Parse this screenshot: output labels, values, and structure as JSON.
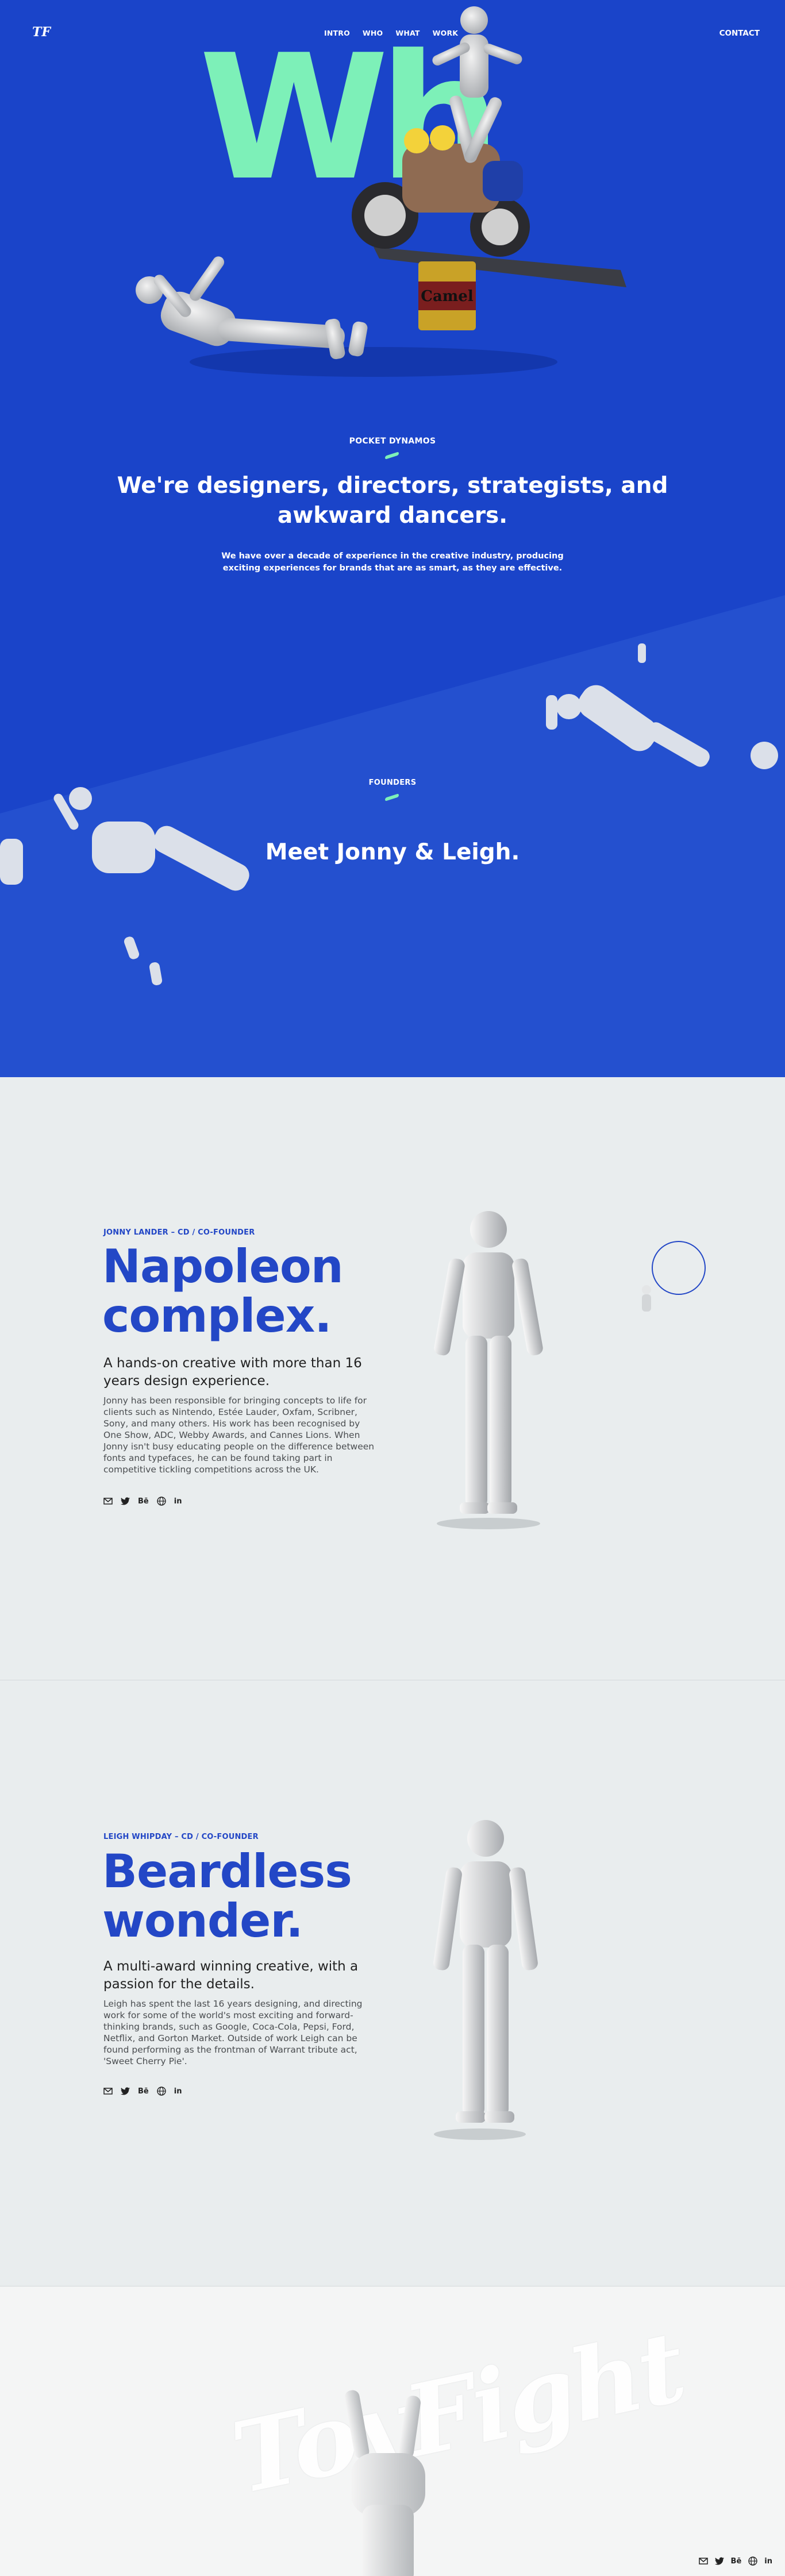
{
  "header": {
    "logo": "TF",
    "nav": [
      "INTRO",
      "WHO",
      "WHAT",
      "WORK"
    ],
    "contact": "CONTACT"
  },
  "hero": {
    "big_word": "Wh",
    "eyebrow": "POCKET DYNAMOS",
    "headline": "We're designers, directors, strategists, and awkward dancers.",
    "lede": "We have over a decade of experience in the creative industry, producing exciting experiences for brands that are as smart, as they are effective."
  },
  "founders": {
    "eyebrow": "FOUNDERS",
    "headline": "Meet Jonny & Leigh."
  },
  "profiles": [
    {
      "role": "JONNY LANDER – CD / CO-FOUNDER",
      "title": "Napoleon complex.",
      "subtitle": "A hands-on creative with more than 16 years design experience.",
      "body": "Jonny has been responsible for bringing concepts to life for clients such as Nintendo, Estée Lauder, Oxfam, Scribner, Sony, and many others. His work has been recognised by One Show, ADC, Webby Awards, and Cannes Lions. When Jonny isn't busy educating people on the difference between fonts and typefaces, he can be found taking part in competitive tickling competitions across the UK.",
      "socials": [
        "email-icon",
        "twitter-icon",
        "Bē",
        "globe-icon",
        "in"
      ]
    },
    {
      "role": "LEIGH WHIPDAY – CD / CO-FOUNDER",
      "title": "Beardless wonder.",
      "subtitle": "A multi-award winning creative, with a passion for the details.",
      "body": "Leigh has spent the last 16 years designing, and directing work for some of the world's most exciting and forward-thinking brands, such as Google, Coca-Cola, Pepsi, Ford, Netflix, and Gorton Market. Outside of work Leigh can be found performing as the frontman of Warrant tribute act, 'Sweet Cherry Pie'.",
      "socials": [
        "email-icon",
        "twitter-icon",
        "Bē",
        "globe-icon",
        "in"
      ]
    }
  ],
  "footer": {
    "word": "ToyFight",
    "socials": [
      "email-icon",
      "twitter-icon",
      "Bē",
      "globe-icon",
      "in"
    ]
  },
  "colors": {
    "brand_blue": "#1a44c9",
    "mint": "#7df0b8",
    "profile_bg": "#e9edee",
    "title_blue": "#2347c6"
  }
}
